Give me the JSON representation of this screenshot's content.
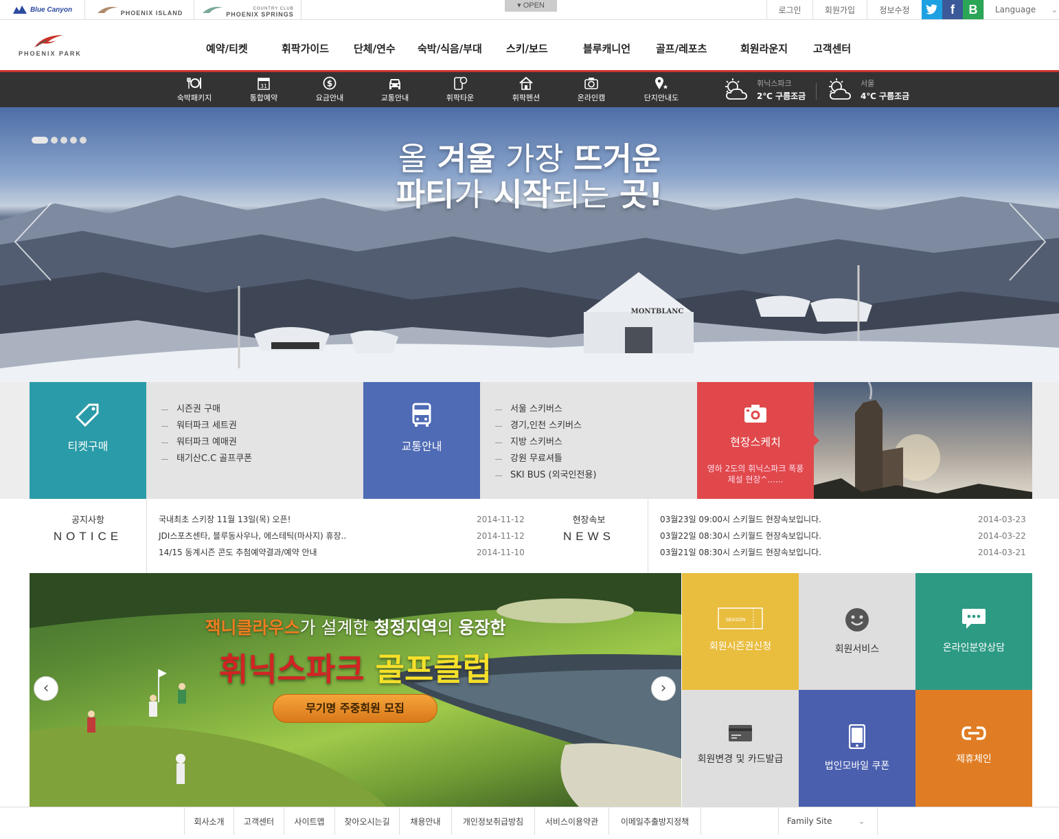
{
  "topbar": {
    "sites": [
      "Blue Canyon",
      "PHOENIX ISLAND",
      "PHOENIX SPRINGS"
    ],
    "springs_sub": "COUNTRY CLUB",
    "open_label": "OPEN",
    "login": "로그인",
    "join": "회원가입",
    "edit": "정보수정",
    "sns": [
      "twitter-icon",
      "facebook-icon",
      "blog-icon"
    ],
    "sns_colors": [
      "#1da1e2",
      "#3b5998",
      "#2aa656"
    ],
    "language": "Language"
  },
  "header": {
    "brand": "PHOENIX PARK",
    "nav": [
      "예약/티켓",
      "휘팍가이드",
      "단체/연수",
      "숙박/식음/부대",
      "스키/보드",
      "블루캐니언",
      "골프/레포츠",
      "회원라운지",
      "고객센터"
    ]
  },
  "quickbar": {
    "items": [
      "숙박패키지",
      "통합예약",
      "요금안내",
      "교통안내",
      "휘팍타운",
      "휘팍펜션",
      "온라인캠",
      "단지안내도"
    ],
    "calendar_day": "31",
    "weather": [
      {
        "loc": "휘닉스파크",
        "temp": "2℃ 구름조금"
      },
      {
        "loc": "서울",
        "temp": "4℃ 구름조금"
      }
    ]
  },
  "hero": {
    "line1": [
      "올 ",
      "겨울",
      " 가장 ",
      "뜨거운"
    ],
    "line2": [
      "파티",
      "가 ",
      "시작",
      "되는 ",
      "곳!"
    ],
    "sign": "MONTBLANC"
  },
  "tiles": {
    "ticket": {
      "label": "티켓구매",
      "color": "#2a9ba8",
      "items": [
        "시즌권 구매",
        "워터파크 세트권",
        "워터파크 예매권",
        "태기산C.C 골프쿠폰"
      ]
    },
    "traffic": {
      "label": "교통안내",
      "color": "#4f6bb5",
      "items": [
        "서울 스키버스",
        "경기,인천 스키버스",
        "지방 스키버스",
        "강원 무료셔틀",
        "SKI BUS (외국인전용)"
      ]
    },
    "sketch": {
      "label": "현장스케치",
      "color": "#e0484b",
      "desc": "영하 2도의 휘닉스파크 폭풍제설 현장^......"
    }
  },
  "notice": {
    "ko": "공지사항",
    "en": "NOTICE",
    "rows": [
      {
        "title": "국내최초 스키장 11월 13일(목) 오픈!",
        "date": "2014-11-12"
      },
      {
        "title": "JDI스포츠센타, 블루동사우나, 에스테틱(마사지) 휴장..",
        "date": "2014-11-12"
      },
      {
        "title": "14/15 동계시즌 콘도 추첨예약결과/예약 안내",
        "date": "2014-11-10"
      }
    ]
  },
  "news": {
    "ko": "현장속보",
    "en": "NEWS",
    "rows": [
      {
        "title": "03월23일 09:00시 스키월드 현장속보입니다.",
        "date": "2014-03-23"
      },
      {
        "title": "03월22일 08:30시 스키월드 현장속보입니다.",
        "date": "2014-03-22"
      },
      {
        "title": "03월21일 08:30시 스키월드 현장속보입니다.",
        "date": "2014-03-21"
      }
    ]
  },
  "golf": {
    "line1": [
      "잭니클라우스",
      "가 설계한 ",
      "청정지역",
      "의 ",
      "웅장한"
    ],
    "line2": [
      "휘닉스파크",
      " ",
      "골프클럽"
    ],
    "button": "무기명 주중회원 모집"
  },
  "grid": {
    "items": [
      {
        "label": "회원시즌권신청",
        "color": "#e9bd3e",
        "icon": "season-ticket-icon",
        "badge": "SEASON"
      },
      {
        "label": "회원서비스",
        "color": "#dedede",
        "icon": "smile-icon"
      },
      {
        "label": "온라인분양상담",
        "color": "#2d9a84",
        "icon": "chat-bubble-icon"
      },
      {
        "label": "회원변경 및 카드발급",
        "color": "#dedede",
        "icon": "card-icon"
      },
      {
        "label": "법인모바일 쿠폰",
        "color": "#4a5fae",
        "icon": "mobile-icon"
      },
      {
        "label": "제휴체인",
        "color": "#e07d24",
        "icon": "chain-icon"
      }
    ]
  },
  "footer": {
    "links": [
      "회사소개",
      "고객센터",
      "사이트맵",
      "찾아오시는길",
      "채용안내",
      "개인정보취급방침",
      "서비스이용약관",
      "이메일추출방지정책"
    ],
    "family_site": "Family Site"
  }
}
